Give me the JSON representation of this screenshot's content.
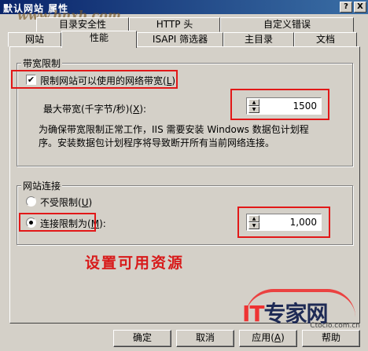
{
  "window": {
    "title": "默认网站 属性",
    "watermark": "www.bnxb.com",
    "help_glyph": "?",
    "close_glyph": "X"
  },
  "tabs_row1": [
    "目录安全性",
    "HTTP 头",
    "自定义错误"
  ],
  "tabs_row2": [
    "网站",
    "性能",
    "ISAPI 筛选器",
    "主目录",
    "文档"
  ],
  "active_tab": "性能",
  "bandwidth": {
    "group_label": "带宽限制",
    "limit_checkbox": {
      "label_prefix": "限制网站可以使用的网络带宽",
      "mnemonic": "L",
      "label_suffix": ")",
      "open": "(",
      "checked": true,
      "check_glyph": "✔"
    },
    "max_label": {
      "prefix": "最大带宽(千字节/秒)",
      "open": "(",
      "mnemonic": "X",
      "suffix": "):"
    },
    "max_value": "1500",
    "note_line1": "为确保带宽限制正常工作，IIS 需要安装 Windows 数据包计划程",
    "note_line2": "序。安装数据包计划程序将导致断开所有当前网络连接。"
  },
  "connections": {
    "group_label": "网站连接",
    "unlimited": {
      "label_prefix": "不受限制",
      "open": "(",
      "mnemonic": "U",
      "suffix": ")",
      "selected": false
    },
    "limited": {
      "label_prefix": "连接限制为",
      "open": "(",
      "mnemonic": "M",
      "suffix": "):",
      "selected": true
    },
    "limit_value": "1,000"
  },
  "annotation": "设置可用资源",
  "logo": {
    "it": "IT",
    "rest": "专家网",
    "url": "Ctocio.com.cn"
  },
  "buttons": {
    "ok": "确定",
    "cancel": "取消",
    "apply_prefix": "应用",
    "apply_open": "(",
    "apply_mnemonic": "A",
    "apply_suffix": ")",
    "help": "帮助"
  },
  "colors": {
    "highlight": "#e21818",
    "titlebar": "#0a246a",
    "face": "#d4d0c8"
  }
}
